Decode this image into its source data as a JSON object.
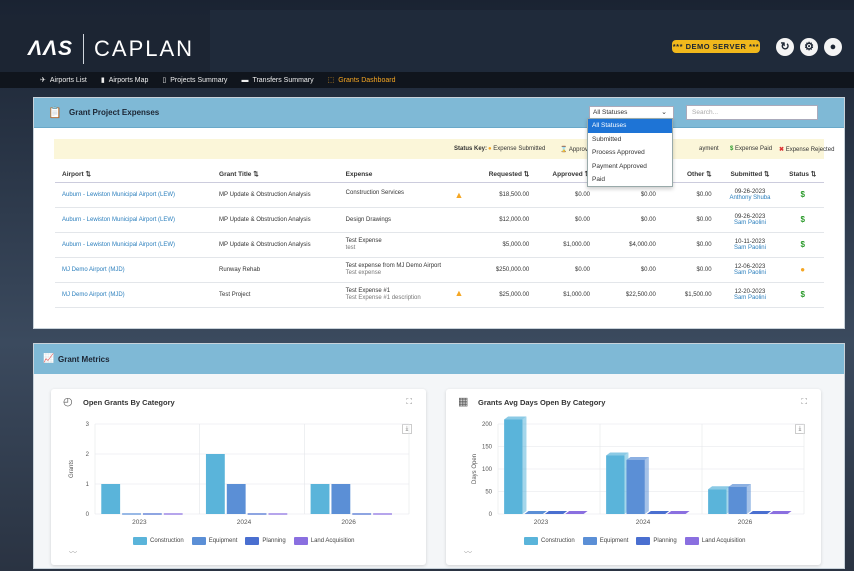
{
  "header": {
    "logo_mark": "ΛΛS",
    "app_name": "CAPLAN",
    "demo_badge": "*** DEMO SERVER ***"
  },
  "nav": [
    {
      "label": "Airports List",
      "icon": "✈"
    },
    {
      "label": "Airports Map",
      "icon": "▮"
    },
    {
      "label": "Projects Summary",
      "icon": "▯"
    },
    {
      "label": "Transfers Summary",
      "icon": "▬"
    },
    {
      "label": "Grants Dashboard",
      "icon": "⬚"
    }
  ],
  "expenses": {
    "title": "Grant Project Expenses",
    "status_select": "All Statuses",
    "search_placeholder": "Search...",
    "status_options": [
      "All Statuses",
      "Submitted",
      "Process Approved",
      "Payment Approved",
      "Paid"
    ],
    "status_key_label": "Status Key:",
    "status_key": [
      "Expense Submitted",
      "Approved for P",
      "ayment",
      "Expense Paid",
      "Expense Rejected"
    ],
    "columns": [
      "Airport ⇅",
      "Grant Title ⇅",
      "Expense",
      "Requested ⇅",
      "Approved ⇅",
      "",
      "Other ⇅",
      "Submitted ⇅",
      "Status ⇅"
    ],
    "rows": [
      {
        "airport": "Auburn - Lewiston Municipal Airport  (LEW)",
        "grant": "MP Update & Obstruction Analysis",
        "expense": "Construction Services",
        "expense_sub": "",
        "warn": true,
        "requested": "$18,500.00",
        "approved": "$0.00",
        "third": "$0.00",
        "other": "$0.00",
        "date": "09-26-2023",
        "by": "Anthony Shuba",
        "status": "$"
      },
      {
        "airport": "Auburn - Lewiston Municipal Airport  (LEW)",
        "grant": "MP Update & Obstruction Analysis",
        "expense": "Design Drawings",
        "expense_sub": "",
        "warn": false,
        "requested": "$12,000.00",
        "approved": "$0.00",
        "third": "$0.00",
        "other": "$0.00",
        "date": "09-26-2023",
        "by": "Sam Paolini",
        "status": "$"
      },
      {
        "airport": "Auburn - Lewiston Municipal Airport  (LEW)",
        "grant": "MP Update & Obstruction Analysis",
        "expense": "Test Expense",
        "expense_sub": "test",
        "warn": false,
        "requested": "$5,000.00",
        "approved": "$1,000.00",
        "third": "$4,000.00",
        "other": "$0.00",
        "date": "10-11-2023",
        "by": "Sam Paolini",
        "status": "$"
      },
      {
        "airport": "MJ Demo Airport  (MJD)",
        "grant": "Runway Rehab",
        "expense": "Test expense from MJ Demo Airport",
        "expense_sub": "Test expense",
        "warn": false,
        "requested": "$250,000.00",
        "approved": "$0.00",
        "third": "$0.00",
        "other": "$0.00",
        "date": "12-06-2023",
        "by": "Sam Paolini",
        "status": "●"
      },
      {
        "airport": "MJ Demo Airport  (MJD)",
        "grant": "Test Project",
        "expense": "Test Expense #1",
        "expense_sub": "Test Expense #1 description",
        "warn": true,
        "requested": "$25,000.00",
        "approved": "$1,000.00",
        "third": "$22,500.00",
        "other": "$1,500.00",
        "date": "12-20-2023",
        "by": "Sam Paolini",
        "status": "$"
      }
    ]
  },
  "metrics": {
    "title": "Grant Metrics",
    "legend": [
      {
        "name": "Construction",
        "color": "#5ab4da"
      },
      {
        "name": "Equipment",
        "color": "#5b8fd6"
      },
      {
        "name": "Planning",
        "color": "#4a6fd0"
      },
      {
        "name": "Land Acquisition",
        "color": "#8a6fe0"
      }
    ]
  },
  "chart_data": [
    {
      "type": "bar",
      "title": "Open Grants By Category",
      "ylabel": "Grants",
      "categories": [
        "2023",
        "2024",
        "2026"
      ],
      "ylim": [
        0,
        3
      ],
      "yticks": [
        "0",
        "1",
        "2",
        "3"
      ],
      "series": [
        {
          "name": "Construction",
          "values": [
            1,
            2,
            1
          ]
        },
        {
          "name": "Equipment",
          "values": [
            0,
            1,
            1
          ]
        },
        {
          "name": "Planning",
          "values": [
            0,
            0,
            0
          ]
        },
        {
          "name": "Land Acquisition",
          "values": [
            0,
            0,
            0
          ]
        }
      ]
    },
    {
      "type": "bar",
      "title": "Grants Avg Days Open By Category",
      "ylabel": "Days Open",
      "categories": [
        "2023",
        "2024",
        "2026"
      ],
      "ylim": [
        0,
        200
      ],
      "yticks": [
        "0",
        "50",
        "100",
        "150",
        "200"
      ],
      "series": [
        {
          "name": "Construction",
          "values": [
            210,
            130,
            55
          ]
        },
        {
          "name": "Equipment",
          "values": [
            0,
            120,
            60
          ]
        },
        {
          "name": "Planning",
          "values": [
            0,
            0,
            0
          ]
        },
        {
          "name": "Land Acquisition",
          "values": [
            0,
            0,
            0
          ]
        }
      ]
    }
  ]
}
